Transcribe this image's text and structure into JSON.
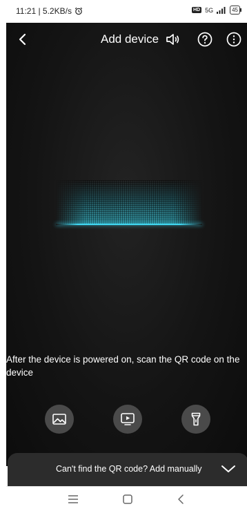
{
  "status_bar": {
    "time_speed": "11:21 | 5.2KB/s",
    "icons": [
      "alarm-icon",
      "hd-icon",
      "signal-icon",
      "battery-icon"
    ],
    "hd": "HD",
    "network": "5G",
    "battery_level": "45"
  },
  "header": {
    "title": "Add device",
    "icons": [
      "back-icon",
      "speaker-icon",
      "help-icon",
      "info-icon"
    ]
  },
  "scanner": {
    "accent_color": "#3fd4ee",
    "hint_text": "After the device is powered on, scan the QR code on the device"
  },
  "actions": [
    {
      "name": "gallery",
      "icon": "image-icon"
    },
    {
      "name": "tutorial",
      "icon": "play-icon"
    },
    {
      "name": "flashlight",
      "icon": "flashlight-icon"
    }
  ],
  "bottom_sheet": {
    "label": "Can't find the QR code? Add manually",
    "icon": "chevron-down-icon"
  },
  "nav_bar": {
    "icons": [
      "menu-icon",
      "home-icon",
      "back-nav-icon"
    ]
  }
}
